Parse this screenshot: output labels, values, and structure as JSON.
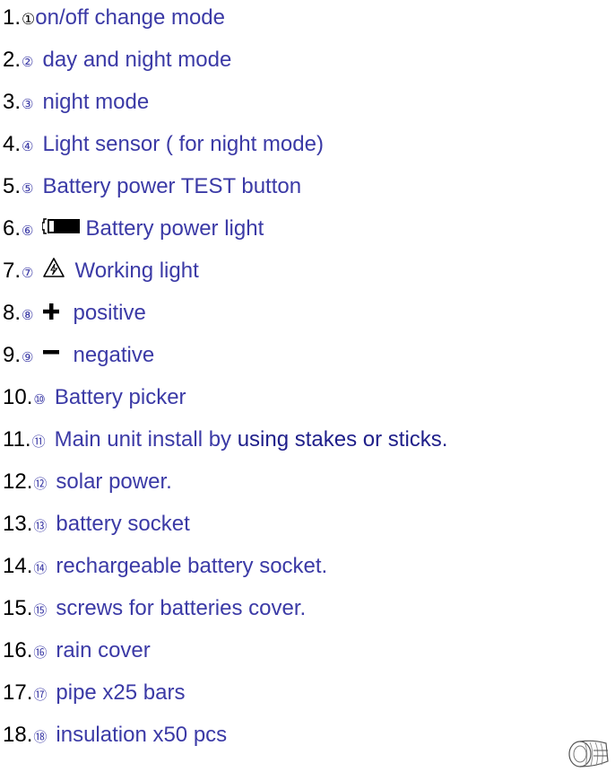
{
  "items": [
    {
      "num": "1.",
      "circ": "①",
      "text": "on/off change mode"
    },
    {
      "num": "2.",
      "circ": "②",
      "text": "day and night mode"
    },
    {
      "num": "3.",
      "circ": "③",
      "text": "night mode"
    },
    {
      "num": "4.",
      "circ": "④",
      "text": "Light sensor ( for night mode)"
    },
    {
      "num": "5.",
      "circ": "⑤",
      "text": "Battery power TEST button"
    },
    {
      "num": "6.",
      "circ": "⑥",
      "text": "Battery power light",
      "icon": "battery-icon"
    },
    {
      "num": "7.",
      "circ": "⑦",
      "text": "Working light",
      "icon": "warning-lightning-icon"
    },
    {
      "num": "8.",
      "circ": "⑧",
      "text": "positive",
      "icon": "plus-icon"
    },
    {
      "num": "9.",
      "circ": "⑨",
      "text": "negative",
      "icon": "minus-icon"
    },
    {
      "num": "10.",
      "circ": "⑩",
      "text": "Battery picker"
    },
    {
      "num": "11.",
      "circ": "⑪",
      "text_a": "Main unit install by ",
      "text_b": "using stakes or sticks."
    },
    {
      "num": "12.",
      "circ": "⑫",
      "text": "solar power."
    },
    {
      "num": "13.",
      "circ": "⑬",
      "text": "battery socket"
    },
    {
      "num": "14.",
      "circ": "⑭",
      "text": "rechargeable battery socket."
    },
    {
      "num": "15.",
      "circ": "⑮",
      "text": "screws for batteries cover."
    },
    {
      "num": "16.",
      "circ": "⑯",
      "text": "rain cover"
    },
    {
      "num": "17.",
      "circ": "⑰",
      "text": "pipe x25 bars"
    },
    {
      "num": "18.",
      "circ": "⑱",
      "text": "insulation x50 pcs"
    }
  ],
  "decor": {
    "coil_icon": "insulation-coil-icon"
  }
}
